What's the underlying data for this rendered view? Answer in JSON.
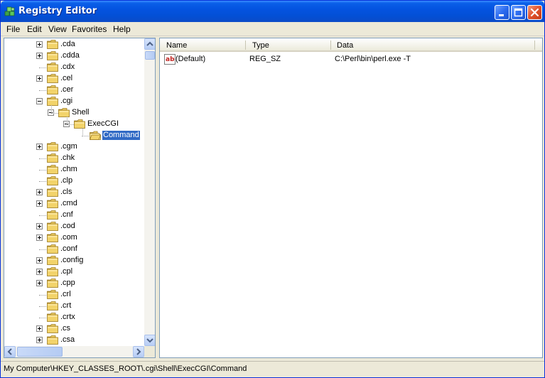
{
  "window": {
    "title": "Registry Editor",
    "colors": {
      "titlebar": "#0453E0",
      "selection": "#316AC5",
      "folder": "#F2D36A"
    }
  },
  "menu": [
    {
      "label": "File"
    },
    {
      "label": "Edit"
    },
    {
      "label": "View"
    },
    {
      "label": "Favorites"
    },
    {
      "label": "Help"
    }
  ],
  "tree": [
    {
      "label": ".cda",
      "toggle": "plus",
      "depth": 0
    },
    {
      "label": ".cdda",
      "toggle": "plus",
      "depth": 0
    },
    {
      "label": ".cdx",
      "toggle": "none",
      "depth": 0
    },
    {
      "label": ".cel",
      "toggle": "plus",
      "depth": 0
    },
    {
      "label": ".cer",
      "toggle": "none",
      "depth": 0
    },
    {
      "label": ".cgi",
      "toggle": "minus",
      "depth": 0
    },
    {
      "label": "Shell",
      "toggle": "minus",
      "depth": 1
    },
    {
      "label": "ExecCGI",
      "toggle": "minus",
      "depth": 2
    },
    {
      "label": "Command",
      "toggle": "none",
      "depth": 3,
      "selected": true
    },
    {
      "label": ".cgm",
      "toggle": "plus",
      "depth": 0
    },
    {
      "label": ".chk",
      "toggle": "none",
      "depth": 0
    },
    {
      "label": ".chm",
      "toggle": "none",
      "depth": 0
    },
    {
      "label": ".clp",
      "toggle": "none",
      "depth": 0
    },
    {
      "label": ".cls",
      "toggle": "plus",
      "depth": 0
    },
    {
      "label": ".cmd",
      "toggle": "plus",
      "depth": 0
    },
    {
      "label": ".cnf",
      "toggle": "none",
      "depth": 0
    },
    {
      "label": ".cod",
      "toggle": "plus",
      "depth": 0
    },
    {
      "label": ".com",
      "toggle": "plus",
      "depth": 0
    },
    {
      "label": ".conf",
      "toggle": "none",
      "depth": 0
    },
    {
      "label": ".config",
      "toggle": "plus",
      "depth": 0
    },
    {
      "label": ".cpl",
      "toggle": "plus",
      "depth": 0
    },
    {
      "label": ".cpp",
      "toggle": "plus",
      "depth": 0
    },
    {
      "label": ".crl",
      "toggle": "none",
      "depth": 0
    },
    {
      "label": ".crt",
      "toggle": "none",
      "depth": 0
    },
    {
      "label": ".crtx",
      "toggle": "none",
      "depth": 0
    },
    {
      "label": ".cs",
      "toggle": "plus",
      "depth": 0
    },
    {
      "label": ".csa",
      "toggle": "plus",
      "depth": 0
    }
  ],
  "list": {
    "columns": [
      "Name",
      "Type",
      "Data"
    ],
    "rows": [
      {
        "name": "(Default)",
        "type": "REG_SZ",
        "data": "C:\\Perl\\bin\\perl.exe -T",
        "icon": "string-value-icon"
      }
    ]
  },
  "status": {
    "path": "My Computer\\HKEY_CLASSES_ROOT\\.cgi\\Shell\\ExecCGI\\Command"
  }
}
